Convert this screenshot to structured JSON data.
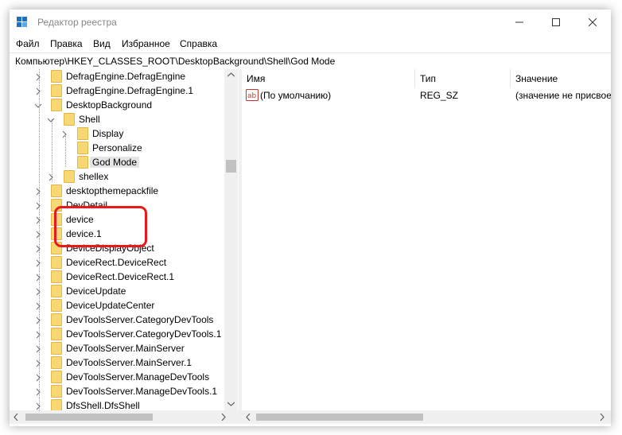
{
  "window": {
    "title": "Редактор реестра",
    "controls": {
      "minimize": "—",
      "maximize": "☐",
      "close": "✕"
    },
    "icon": "regedit-icon"
  },
  "menu": [
    "Файл",
    "Правка",
    "Вид",
    "Избранное",
    "Справка"
  ],
  "address": "Компьютер\\HKEY_CLASSES_ROOT\\DesktopBackground\\Shell\\God Mode",
  "tree": [
    {
      "label": "DefragEngine.DefragEngine",
      "expander": "collapsed"
    },
    {
      "label": "DefragEngine.DefragEngine.1",
      "expander": "collapsed"
    },
    {
      "label": "DesktopBackground",
      "expander": "expanded"
    },
    {
      "label": "Shell",
      "expander": "expanded"
    },
    {
      "label": "Display",
      "expander": "collapsed"
    },
    {
      "label": "Personalize",
      "expander": "none"
    },
    {
      "label": "God Mode",
      "expander": "none",
      "selected": true
    },
    {
      "label": "shellex",
      "expander": "collapsed"
    },
    {
      "label": "desktopthemepackfile",
      "expander": "collapsed"
    },
    {
      "label": "DevDetail",
      "expander": "collapsed"
    },
    {
      "label": "device",
      "expander": "collapsed"
    },
    {
      "label": "device.1",
      "expander": "collapsed"
    },
    {
      "label": "DeviceDisplayObject",
      "expander": "collapsed"
    },
    {
      "label": "DeviceRect.DeviceRect",
      "expander": "collapsed"
    },
    {
      "label": "DeviceRect.DeviceRect.1",
      "expander": "collapsed"
    },
    {
      "label": "DeviceUpdate",
      "expander": "collapsed"
    },
    {
      "label": "DeviceUpdateCenter",
      "expander": "collapsed"
    },
    {
      "label": "DevToolsServer.CategoryDevTools",
      "expander": "collapsed"
    },
    {
      "label": "DevToolsServer.CategoryDevTools.1",
      "expander": "collapsed"
    },
    {
      "label": "DevToolsServer.MainServer",
      "expander": "collapsed"
    },
    {
      "label": "DevToolsServer.MainServer.1",
      "expander": "collapsed"
    },
    {
      "label": "DevToolsServer.ManageDevTools",
      "expander": "collapsed"
    },
    {
      "label": "DevToolsServer.ManageDevTools.1",
      "expander": "collapsed"
    },
    {
      "label": "DfsShell.DfsShell",
      "expander": "collapsed"
    }
  ],
  "columns": [
    "Имя",
    "Тип",
    "Значение"
  ],
  "values": [
    {
      "name": "(По умолчанию)",
      "type": "REG_SZ",
      "data": "(значение не присвоено)",
      "icon": "string-value-icon"
    }
  ],
  "colors": {
    "highlight": "#e8191d",
    "folder": "#f8d775",
    "selection": "#e5e5e5"
  }
}
